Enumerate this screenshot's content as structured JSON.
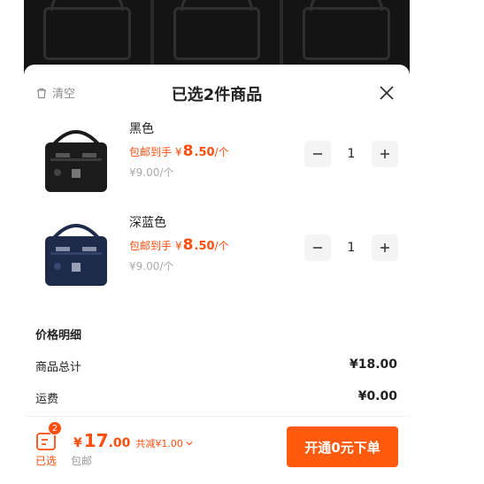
{
  "header": {
    "clear_label": "清空",
    "title": "已选2件商品"
  },
  "items": [
    {
      "name": "黑色",
      "promo_prefix": "包邮到手",
      "currency": "¥",
      "price_int": "8",
      "price_dec": ".50",
      "unit": "/个",
      "orig_price": "¥9.00/个",
      "quantity": "1",
      "color": "#1b1b1b"
    },
    {
      "name": "深蓝色",
      "promo_prefix": "包邮到手",
      "currency": "¥",
      "price_int": "8",
      "price_dec": ".50",
      "unit": "/个",
      "orig_price": "¥9.00/个",
      "quantity": "1",
      "color": "#1e2a4a"
    }
  ],
  "price_details": {
    "title": "价格明细",
    "subtotal_label": "商品总计",
    "subtotal_value": "¥18.00",
    "shipping_label": "运费",
    "shipping_value": "¥0.00"
  },
  "footer": {
    "badge_count": "2",
    "selected_label": "已选",
    "shipping_label": "包邮",
    "currency": "¥",
    "total_int": "17",
    "total_dec": ".00",
    "saved_text": "共减¥1.00",
    "checkout_label": "开通0元下单"
  },
  "colors": {
    "accent": "#ff4d0e",
    "checkout_bg": "#ff5a0e"
  }
}
